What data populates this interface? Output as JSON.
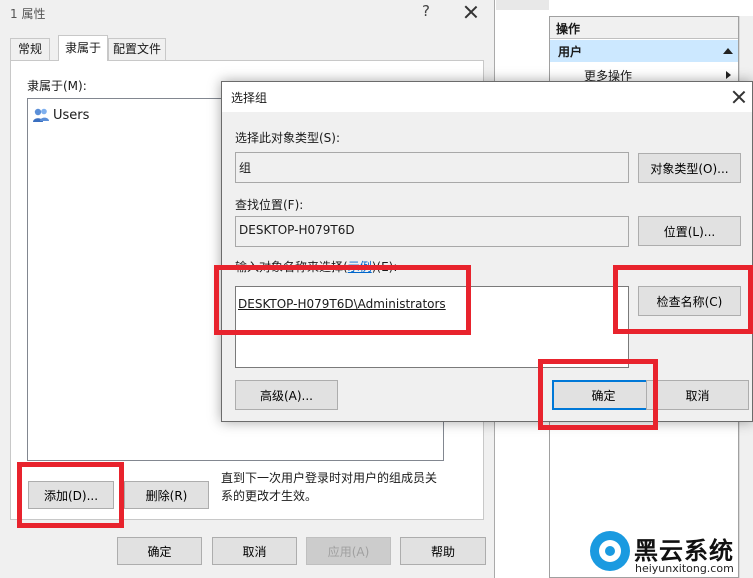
{
  "background_window": {
    "partial_title": "1 属性",
    "help_glyph": "?",
    "tabs": [
      {
        "label": "常规",
        "active": false
      },
      {
        "label": "隶属于",
        "active": true
      },
      {
        "label": "配置文件",
        "active": false
      }
    ],
    "member_of_label": "隶属于(M):",
    "members": [
      "Users"
    ],
    "note": [
      "直到下一次用户登录时对用户的组成员关",
      "系的更改才生效。"
    ],
    "add_label": "添加(D)...",
    "remove_label": "删除(R)",
    "ok_label": "确定",
    "cancel_label": "取消",
    "apply_label": "应用(A)",
    "help_label": "帮助"
  },
  "actions_pane": {
    "header": "操作",
    "section": "用户",
    "more_actions": "更多操作"
  },
  "dialog": {
    "title": "选择组",
    "object_type_label": "选择此对象类型(S):",
    "object_type_value": "组",
    "object_types_button": "对象类型(O)...",
    "location_label": "查找位置(F):",
    "location_value": "DESKTOP-H079T6D",
    "locations_button": "位置(L)...",
    "names_label_prefix": "输入对象名称来选择(",
    "names_label_link": "示例",
    "names_label_suffix": ")(E):",
    "names_value": "DESKTOP-H079T6D\\Administrators",
    "check_names_button": "检查名称(C)",
    "advanced_button": "高级(A)...",
    "ok_button": "确定",
    "cancel_button": "取消"
  },
  "watermark": {
    "brand": "黑云系统",
    "url": "heiyunxitong.com"
  },
  "colors": {
    "highlight": "#e8232d",
    "accent": "#0078d7",
    "selected_header": "#cce8ff"
  }
}
